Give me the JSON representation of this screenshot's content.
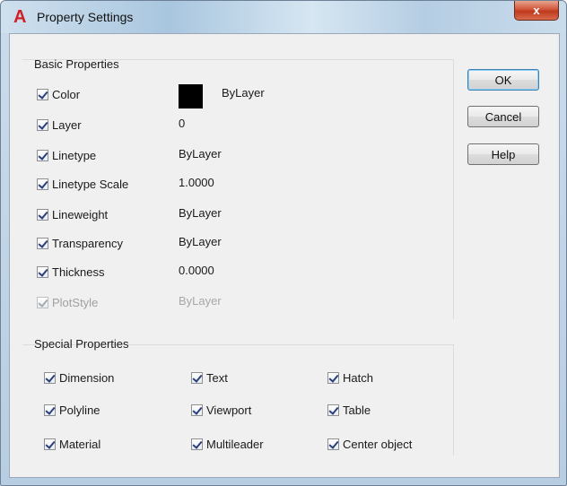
{
  "window": {
    "title": "Property Settings",
    "app_icon": "autocad-a-icon",
    "close_label": "x"
  },
  "basic": {
    "heading": "Basic Properties",
    "color_swatch": "#000000",
    "rows": [
      {
        "label": "Color",
        "value": "ByLayer",
        "checked": true,
        "enabled": true
      },
      {
        "label": "Layer",
        "value": "0",
        "checked": true,
        "enabled": true
      },
      {
        "label": "Linetype",
        "value": "ByLayer",
        "checked": true,
        "enabled": true
      },
      {
        "label": "Linetype Scale",
        "value": "1.0000",
        "checked": true,
        "enabled": true
      },
      {
        "label": "Lineweight",
        "value": "ByLayer",
        "checked": true,
        "enabled": true
      },
      {
        "label": "Transparency",
        "value": "ByLayer",
        "checked": true,
        "enabled": true
      },
      {
        "label": "Thickness",
        "value": "0.0000",
        "checked": true,
        "enabled": true
      },
      {
        "label": "PlotStyle",
        "value": "ByLayer",
        "checked": true,
        "enabled": false
      }
    ]
  },
  "special": {
    "heading": "Special Properties",
    "items": [
      {
        "label": "Dimension",
        "checked": true
      },
      {
        "label": "Text",
        "checked": true
      },
      {
        "label": "Hatch",
        "checked": true
      },
      {
        "label": "Polyline",
        "checked": true
      },
      {
        "label": "Viewport",
        "checked": true
      },
      {
        "label": "Table",
        "checked": true
      },
      {
        "label": "Material",
        "checked": true
      },
      {
        "label": "Multileader",
        "checked": true
      },
      {
        "label": "Center object",
        "checked": true
      }
    ]
  },
  "buttons": {
    "ok": "OK",
    "cancel": "Cancel",
    "help": "Help"
  }
}
